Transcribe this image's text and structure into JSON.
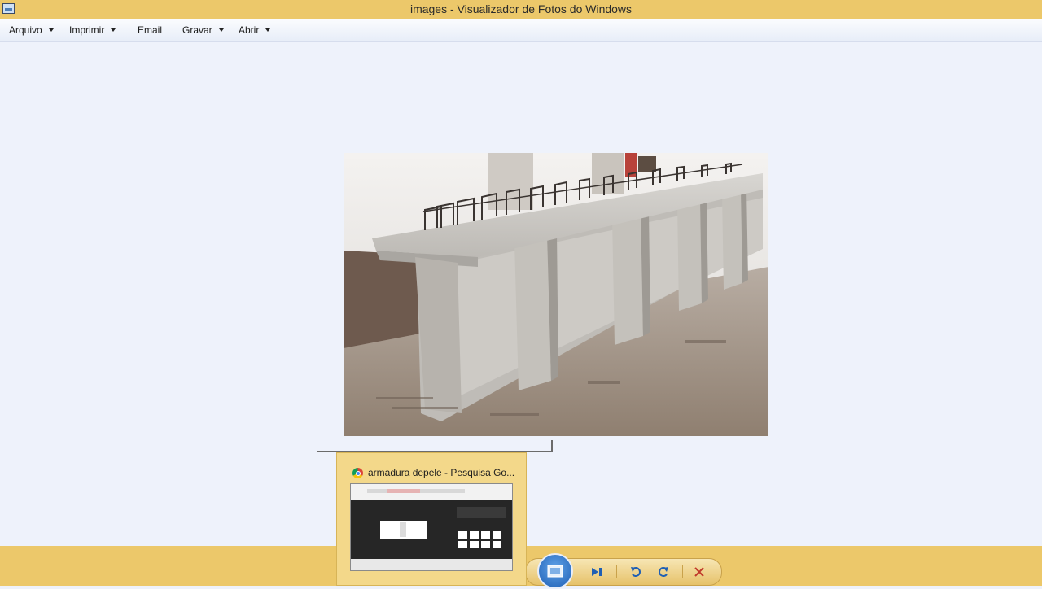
{
  "window": {
    "title": "images - Visualizador de Fotos do Windows",
    "app_icon": "photo-viewer-icon"
  },
  "menu": [
    {
      "label": "Arquivo",
      "has_dropdown": true
    },
    {
      "label": "Imprimir",
      "has_dropdown": true
    },
    {
      "label": "Email",
      "has_dropdown": false
    },
    {
      "label": "Gravar",
      "has_dropdown": true
    },
    {
      "label": "Abrir",
      "has_dropdown": true
    }
  ],
  "photo": {
    "subject": "concrete-beam-with-rebar"
  },
  "taskbar_preview": {
    "title": "armadura depele - Pesquisa Go...",
    "icon": "chrome-icon"
  },
  "controls": {
    "icons": [
      "slideshow-icon",
      "next-icon",
      "rotate-left-icon",
      "rotate-right-icon",
      "delete-icon"
    ]
  },
  "colors": {
    "frame": "#ecc86a",
    "canvas": "#eef2fb",
    "accent_blue": "#1f5fb4",
    "delete_red": "#c0392b"
  }
}
